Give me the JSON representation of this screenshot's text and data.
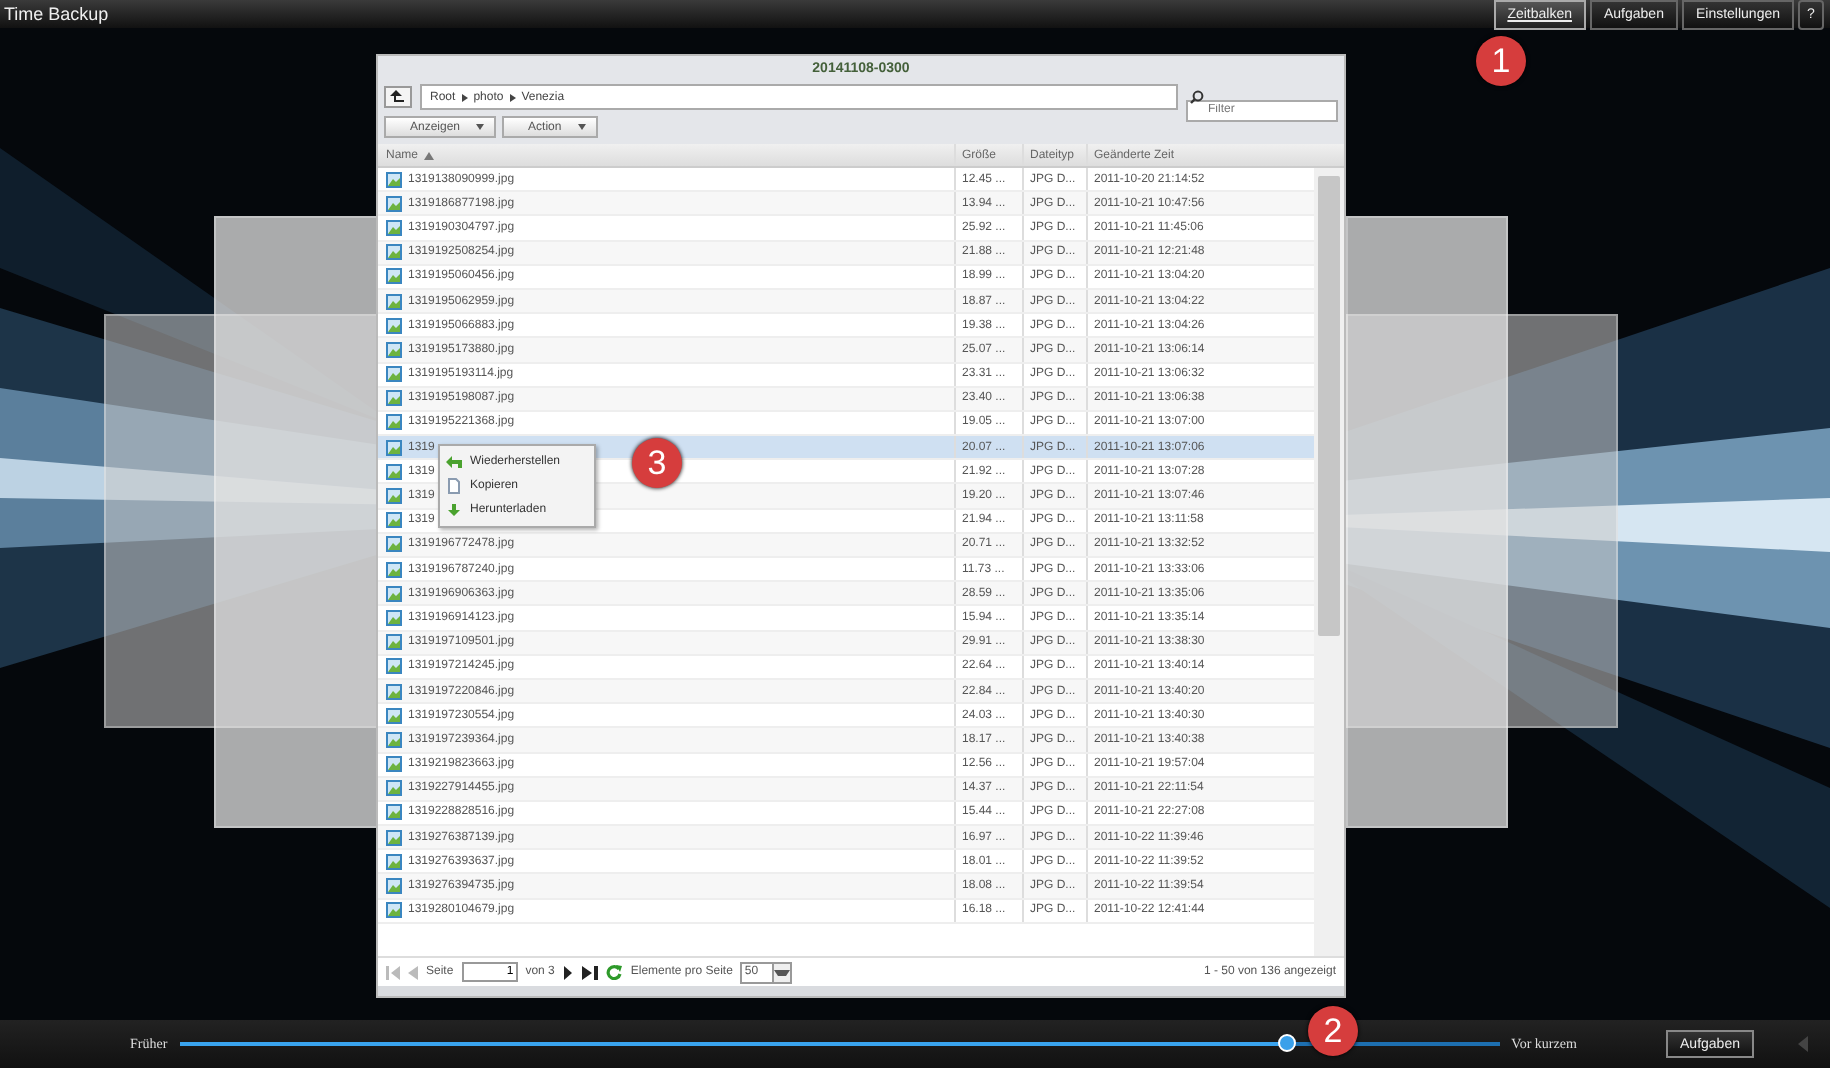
{
  "app_title": "Time Backup",
  "top_tabs": [
    {
      "label": "Zeitbalken",
      "selected": true
    },
    {
      "label": "Aufgaben",
      "selected": false
    },
    {
      "label": "Einstellungen",
      "selected": false
    }
  ],
  "help": "?",
  "dialog": {
    "title": "20141108-0300",
    "path": [
      "Root",
      "photo",
      "Venezia"
    ],
    "filter": {
      "placeholder": "Filter"
    },
    "toolbar": [
      "Anzeigen",
      "Action"
    ],
    "columns": [
      "Name",
      "Größe",
      "Dateityp",
      "Geänderte Zeit"
    ],
    "rows": [
      {
        "name": "1319138090999.jpg",
        "size": "12.45 ...",
        "type": "JPG D...",
        "modified": "2011-10-20 21:14:52",
        "selected": false
      },
      {
        "name": "1319186877198.jpg",
        "size": "13.94 ...",
        "type": "JPG D...",
        "modified": "2011-10-21 10:47:56",
        "selected": false
      },
      {
        "name": "1319190304797.jpg",
        "size": "25.92 ...",
        "type": "JPG D...",
        "modified": "2011-10-21 11:45:06",
        "selected": false
      },
      {
        "name": "1319192508254.jpg",
        "size": "21.88 ...",
        "type": "JPG D...",
        "modified": "2011-10-21 12:21:48",
        "selected": false
      },
      {
        "name": "1319195060456.jpg",
        "size": "18.99 ...",
        "type": "JPG D...",
        "modified": "2011-10-21 13:04:20",
        "selected": false
      },
      {
        "name": "1319195062959.jpg",
        "size": "18.87 ...",
        "type": "JPG D...",
        "modified": "2011-10-21 13:04:22",
        "selected": false
      },
      {
        "name": "1319195066883.jpg",
        "size": "19.38 ...",
        "type": "JPG D...",
        "modified": "2011-10-21 13:04:26",
        "selected": false
      },
      {
        "name": "1319195173880.jpg",
        "size": "25.07 ...",
        "type": "JPG D...",
        "modified": "2011-10-21 13:06:14",
        "selected": false
      },
      {
        "name": "1319195193114.jpg",
        "size": "23.31 ...",
        "type": "JPG D...",
        "modified": "2011-10-21 13:06:32",
        "selected": false
      },
      {
        "name": "1319195198087.jpg",
        "size": "23.40 ...",
        "type": "JPG D...",
        "modified": "2011-10-21 13:06:38",
        "selected": false
      },
      {
        "name": "1319195221368.jpg",
        "size": "19.05 ...",
        "type": "JPG D...",
        "modified": "2011-10-21 13:07:00",
        "selected": false
      },
      {
        "name": "1319",
        "size": "20.07 ...",
        "type": "JPG D...",
        "modified": "2011-10-21 13:07:06",
        "selected": true
      },
      {
        "name": "1319",
        "size": "21.92 ...",
        "type": "JPG D...",
        "modified": "2011-10-21 13:07:28",
        "selected": false
      },
      {
        "name": "1319",
        "size": "19.20 ...",
        "type": "JPG D...",
        "modified": "2011-10-21 13:07:46",
        "selected": false
      },
      {
        "name": "1319",
        "size": "21.94 ...",
        "type": "JPG D...",
        "modified": "2011-10-21 13:11:58",
        "selected": false
      },
      {
        "name": "1319196772478.jpg",
        "size": "20.71 ...",
        "type": "JPG D...",
        "modified": "2011-10-21 13:32:52",
        "selected": false
      },
      {
        "name": "1319196787240.jpg",
        "size": "11.73 ...",
        "type": "JPG D...",
        "modified": "2011-10-21 13:33:06",
        "selected": false
      },
      {
        "name": "1319196906363.jpg",
        "size": "28.59 ...",
        "type": "JPG D...",
        "modified": "2011-10-21 13:35:06",
        "selected": false
      },
      {
        "name": "1319196914123.jpg",
        "size": "15.94 ...",
        "type": "JPG D...",
        "modified": "2011-10-21 13:35:14",
        "selected": false
      },
      {
        "name": "1319197109501.jpg",
        "size": "29.91 ...",
        "type": "JPG D...",
        "modified": "2011-10-21 13:38:30",
        "selected": false
      },
      {
        "name": "1319197214245.jpg",
        "size": "22.64 ...",
        "type": "JPG D...",
        "modified": "2011-10-21 13:40:14",
        "selected": false
      },
      {
        "name": "1319197220846.jpg",
        "size": "22.84 ...",
        "type": "JPG D...",
        "modified": "2011-10-21 13:40:20",
        "selected": false
      },
      {
        "name": "1319197230554.jpg",
        "size": "24.03 ...",
        "type": "JPG D...",
        "modified": "2011-10-21 13:40:30",
        "selected": false
      },
      {
        "name": "1319197239364.jpg",
        "size": "18.17 ...",
        "type": "JPG D...",
        "modified": "2011-10-21 13:40:38",
        "selected": false
      },
      {
        "name": "1319219823663.jpg",
        "size": "12.56 ...",
        "type": "JPG D...",
        "modified": "2011-10-21 19:57:04",
        "selected": false
      },
      {
        "name": "1319227914455.jpg",
        "size": "14.37 ...",
        "type": "JPG D...",
        "modified": "2011-10-21 22:11:54",
        "selected": false
      },
      {
        "name": "1319228828516.jpg",
        "size": "15.44 ...",
        "type": "JPG D...",
        "modified": "2011-10-21 22:27:08",
        "selected": false
      },
      {
        "name": "1319276387139.jpg",
        "size": "16.97 ...",
        "type": "JPG D...",
        "modified": "2011-10-22 11:39:46",
        "selected": false
      },
      {
        "name": "1319276393637.jpg",
        "size": "18.01 ...",
        "type": "JPG D...",
        "modified": "2011-10-22 11:39:52",
        "selected": false
      },
      {
        "name": "1319276394735.jpg",
        "size": "18.08 ...",
        "type": "JPG D...",
        "modified": "2011-10-22 11:39:54",
        "selected": false
      },
      {
        "name": "1319280104679.jpg",
        "size": "16.18 ...",
        "type": "JPG D...",
        "modified": "2011-10-22 12:41:44",
        "selected": false
      }
    ],
    "context_menu": [
      {
        "label": "Wiederherstellen",
        "kind": "restore"
      },
      {
        "label": "Kopieren",
        "kind": "copy"
      },
      {
        "label": "Herunterladen",
        "kind": "download"
      }
    ],
    "pager": {
      "page_label": "Seite",
      "page": "1",
      "of": "von 3",
      "per_page_label": "Elemente pro Seite",
      "per_page": "50",
      "summary": "1 - 50 von 136 angezeigt"
    }
  },
  "timeline": {
    "start": "Früher",
    "end": "Vor kurzem",
    "level": 0.84,
    "button": "Aufgaben"
  },
  "callouts": [
    "1",
    "2",
    "3"
  ]
}
